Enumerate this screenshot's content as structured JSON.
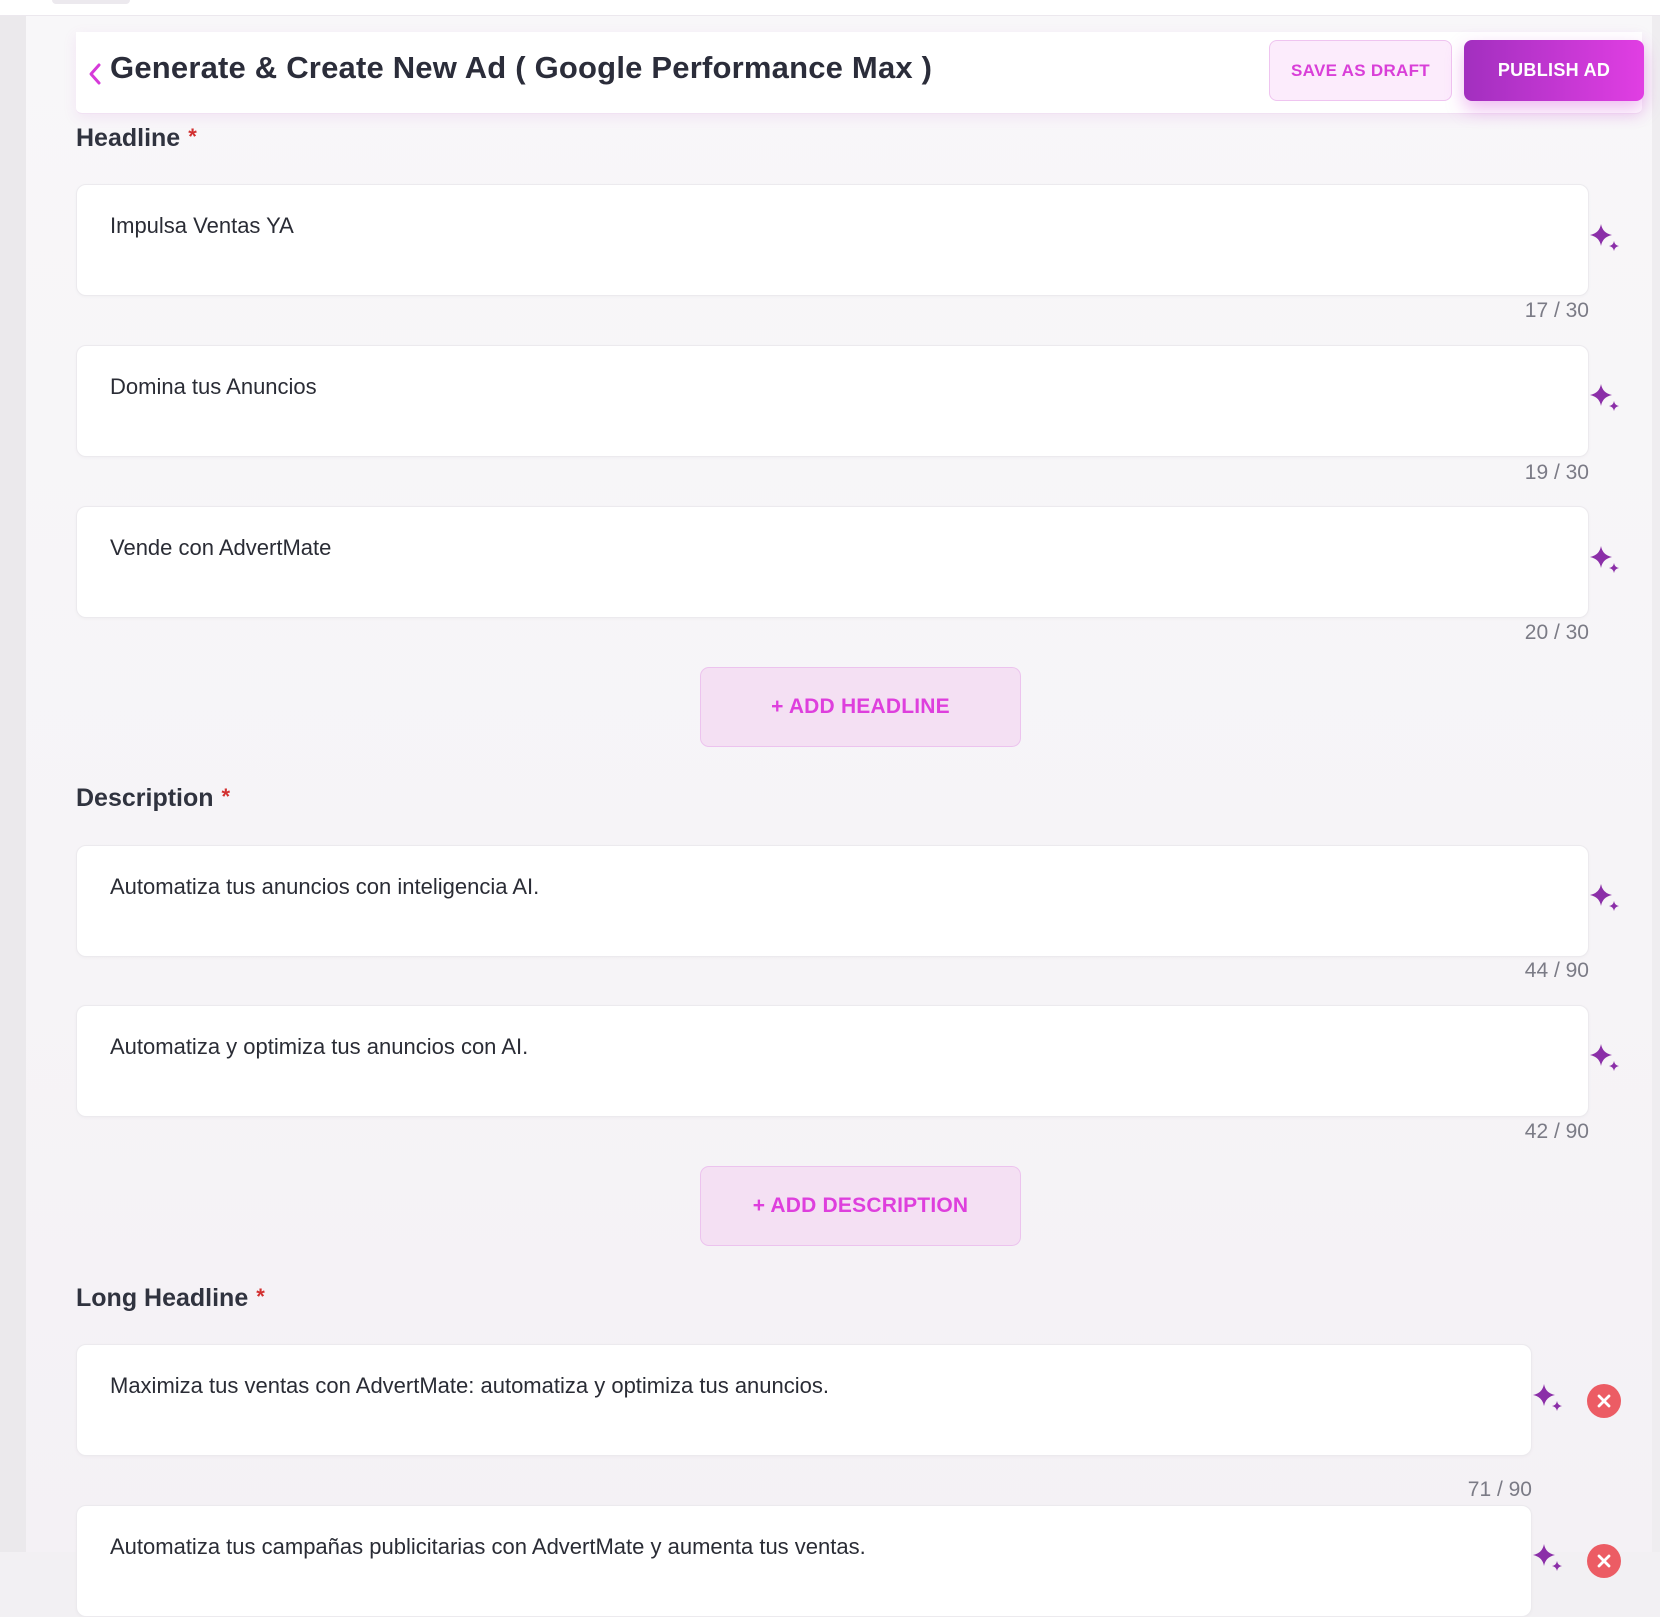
{
  "header": {
    "title": "Generate & Create New Ad ( Google Performance Max )",
    "save_draft_label": "SAVE AS DRAFT",
    "publish_label": "PUBLISH AD"
  },
  "sections": {
    "headline": {
      "label": "Headline",
      "required_mark": "*",
      "items": [
        {
          "value": "Impulsa Ventas YA",
          "counter": "17 / 30"
        },
        {
          "value": "Domina tus Anuncios",
          "counter": "19 / 30"
        },
        {
          "value": "Vende con AdvertMate",
          "counter": "20 / 30"
        }
      ],
      "add_label": "+ ADD HEADLINE"
    },
    "description": {
      "label": "Description",
      "required_mark": "*",
      "items": [
        {
          "value": "Automatiza tus anuncios con inteligencia AI.",
          "counter": "44 / 90"
        },
        {
          "value": "Automatiza y optimiza tus anuncios con AI.",
          "counter": "42 / 90"
        }
      ],
      "add_label": "+ ADD DESCRIPTION"
    },
    "long_headline": {
      "label": "Long Headline",
      "required_mark": "*",
      "items": [
        {
          "value": "Maximiza tus ventas con AdvertMate: automatiza y optimiza tus anuncios.",
          "counter": "71 / 90"
        },
        {
          "value": "Automatiza tus campañas publicitarias con AdvertMate y aumenta tus ventas."
        }
      ]
    }
  },
  "colors": {
    "accent": "#de3fdd",
    "accent_dark": "#a22fbf",
    "sparkle": "#8b2fa8",
    "remove": "#ec5c64",
    "required": "#d23030"
  },
  "icons": {
    "back": "chevron-left-icon",
    "generate": "sparkle-icon",
    "remove": "close-circle-icon"
  }
}
